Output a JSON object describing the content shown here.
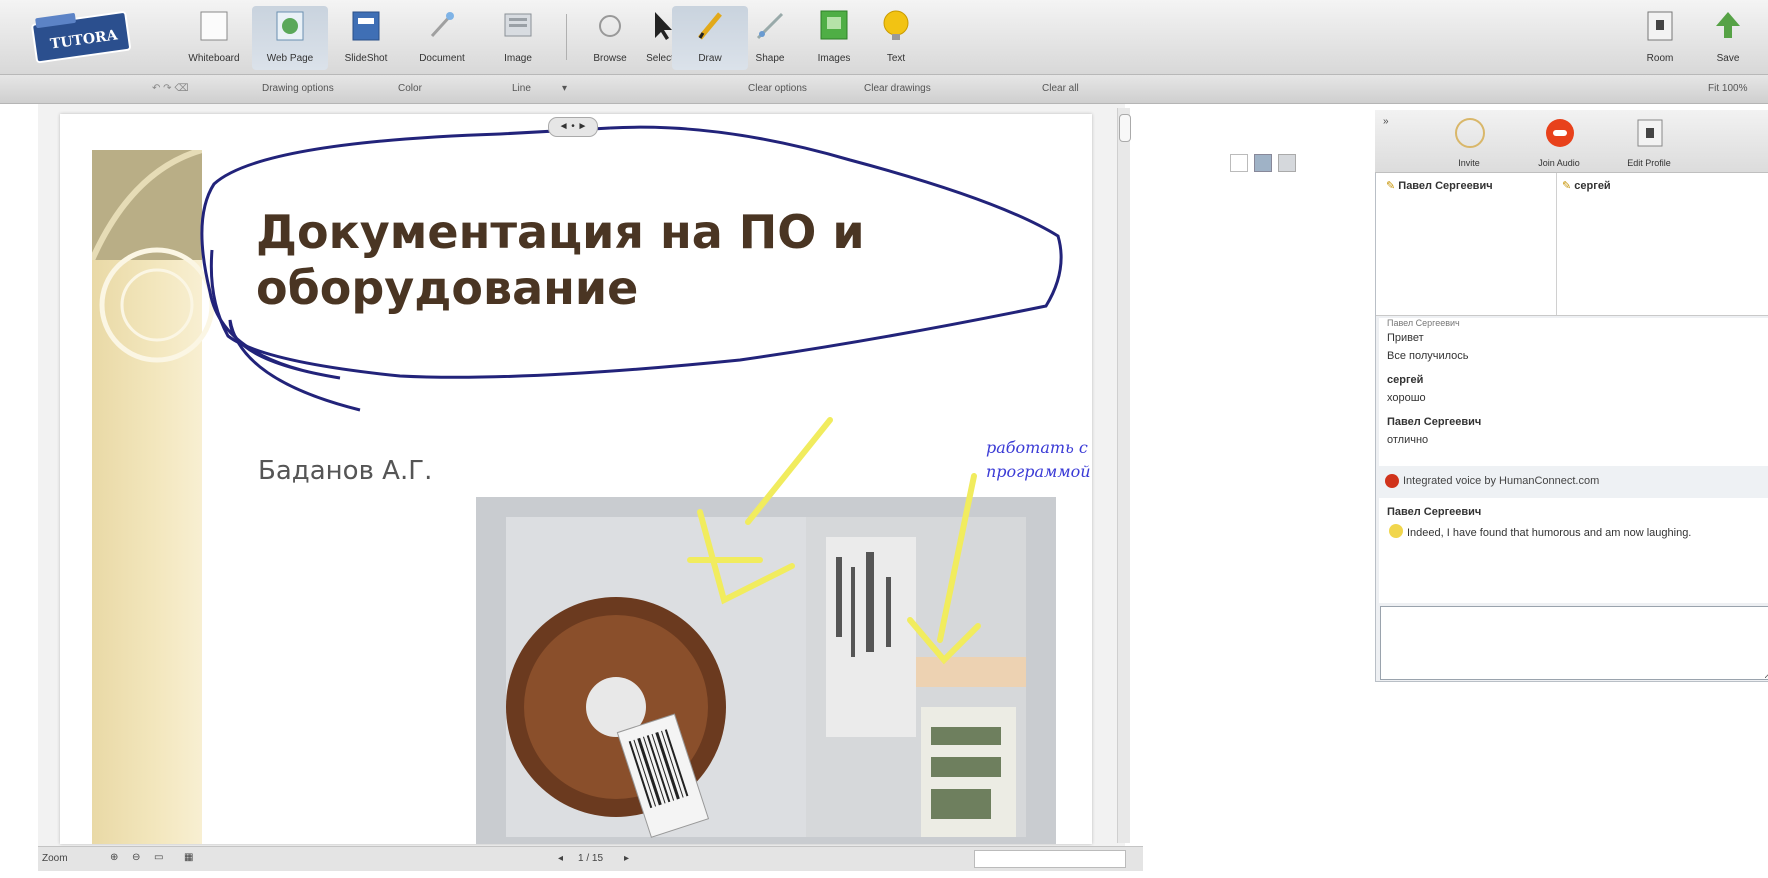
{
  "toolbar": {
    "logo_text": "TUTORA",
    "buttons": [
      {
        "label": "Whiteboard"
      },
      {
        "label": "Web Page"
      },
      {
        "label": "SlideShot"
      },
      {
        "label": "Document"
      },
      {
        "label": "Image"
      },
      {
        "label": "Browse"
      },
      {
        "label": "Select"
      },
      {
        "label": "Draw"
      },
      {
        "label": "Shape"
      },
      {
        "label": "Images"
      },
      {
        "label": "Text"
      }
    ],
    "right_buttons": [
      {
        "label": "Room"
      },
      {
        "label": "Save"
      }
    ]
  },
  "subbar": {
    "drawing_options": "Drawing options",
    "color_label": "Color",
    "line_label": "Line",
    "clear_options": "Clear options",
    "clear_drawings": "Clear drawings",
    "clear_all": "Clear all",
    "zoom_label": "Fit 100%"
  },
  "slide": {
    "handle": "◄ • ►",
    "title": "Документация на ПО и оборудование",
    "author": "Баданов А.Г.",
    "handwriting": "работать с программой"
  },
  "statusbar": {
    "zoom": "Zoom",
    "page": "1 / 15"
  },
  "right_panel": {
    "buttons": [
      {
        "label": "Invite"
      },
      {
        "label": "Join Audio"
      },
      {
        "label": "Edit Profile"
      }
    ],
    "users": [
      {
        "name": "Павел Сергеевич"
      },
      {
        "name": "сергей"
      }
    ],
    "chat": [
      {
        "name": "Павел Сергеевич",
        "text": ""
      },
      {
        "name": "",
        "text": "Привет"
      },
      {
        "name": "",
        "text": "Все получилось"
      },
      {
        "name": "сергей",
        "text": "хорошо"
      },
      {
        "name": "Павел Сергеевич",
        "text": "отлично"
      }
    ],
    "voice_notice": "Integrated voice by HumanConnect.com",
    "last_message": {
      "name": "Павел Сергеевич",
      "text": "Indeed, I have found that humorous and am now laughing."
    },
    "input_value": ""
  },
  "colors": {
    "toolbar_bg": "#dcdcdc",
    "title_color": "#4a3523",
    "annotation_stroke": "#22237a",
    "highlighter": "#f1ec5e",
    "handwriting": "#3b3bd6"
  }
}
